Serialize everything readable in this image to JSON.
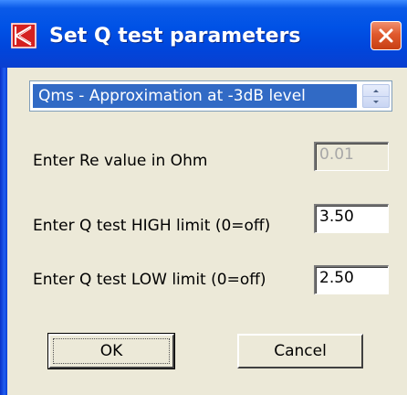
{
  "window": {
    "title": "Set Q test parameters",
    "close_label": "×"
  },
  "mode_select": {
    "value": "Qms - Approximation at -3dB level"
  },
  "fields": [
    {
      "label": "Enter Re value in Ohm",
      "value": "0.01",
      "enabled": false
    },
    {
      "label": "Enter Q test HIGH limit  (0=off)",
      "value": "3.50",
      "enabled": true
    },
    {
      "label": "Enter Q test LOW limit  (0=off)",
      "value": "2.50",
      "enabled": true
    }
  ],
  "buttons": {
    "ok_label": "OK",
    "cancel_label": "Cancel"
  },
  "colors": {
    "titlebar": "#0052e6",
    "selection": "#316ac5",
    "dialog_bg": "#ece9d8",
    "close_button": "#e05a2e",
    "app_icon": "#d42020"
  }
}
